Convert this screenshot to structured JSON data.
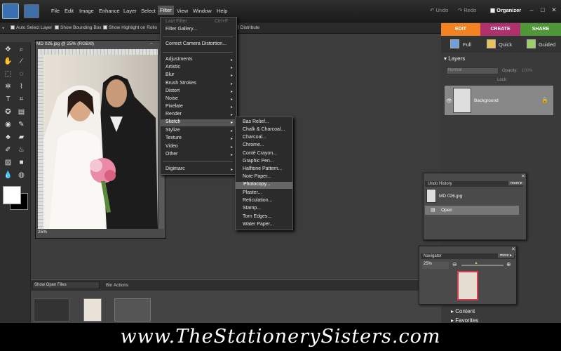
{
  "menubar": {
    "items": [
      "File",
      "Edit",
      "Image",
      "Enhance",
      "Layer",
      "Select",
      "Filter",
      "View",
      "Window",
      "Help"
    ],
    "undo": "Undo",
    "redo": "Redo",
    "organizer": "Organizer",
    "window_buttons": [
      "–",
      "□",
      "✕"
    ]
  },
  "options_bar": {
    "auto_select": "Auto Select Layer",
    "show_bounding": "Show Bounding Box",
    "show_highlight": "Show Highlight on Rollo",
    "distribute": "Distribute"
  },
  "modes": {
    "edit": "EDIT",
    "create": "CREATE",
    "share": "SHARE"
  },
  "edit_tabs": {
    "full": "Full",
    "quick": "Quick",
    "guided": "Guided"
  },
  "document": {
    "title": "MD 026.jpg @ 25% (RGB/8)",
    "zoom": "25%"
  },
  "filter_menu": {
    "last_filter": "Last Filter",
    "last_filter_shortcut": "Ctrl+F",
    "filter_gallery": "Filter Gallery...",
    "correct_camera": "Correct Camera Distortion...",
    "items": [
      "Adjustments",
      "Artistic",
      "Blur",
      "Brush Strokes",
      "Distort",
      "Noise",
      "Pixelate",
      "Render",
      "Sketch",
      "Stylize",
      "Texture",
      "Video",
      "Other"
    ],
    "digimarc": "Digimarc"
  },
  "sketch_submenu": [
    "Bas Relief...",
    "Chalk & Charcoal...",
    "Charcoal...",
    "Chrome...",
    "Conté Crayon...",
    "Graphic Pen...",
    "Halftone Pattern...",
    "Note Paper...",
    "Photocopy...",
    "Plaster...",
    "Reticulation...",
    "Stamp...",
    "Torn Edges...",
    "Water Paper..."
  ],
  "project_bin": {
    "select": "Show Open Files",
    "actions": "Bin Actions"
  },
  "layers_panel": {
    "title": "Layers",
    "blend": "Normal",
    "opacity_label": "Opacity:",
    "opacity_value": "100%",
    "lock_label": "Lock:",
    "layer_name": "Background"
  },
  "undo_history": {
    "title": "Undo History",
    "more": "more ▸",
    "items": [
      "MD 026.jpg",
      "Open"
    ]
  },
  "navigator": {
    "title": "Navigator",
    "more": "more ▸",
    "zoom": "25%"
  },
  "collapsed_panels": {
    "content": "Content",
    "favorites": "Favorites"
  },
  "footer": {
    "text": "www.TheStationerySisters.com"
  },
  "colors": {
    "edit": "#f58220",
    "create": "#b0306d",
    "share": "#4f9838"
  }
}
